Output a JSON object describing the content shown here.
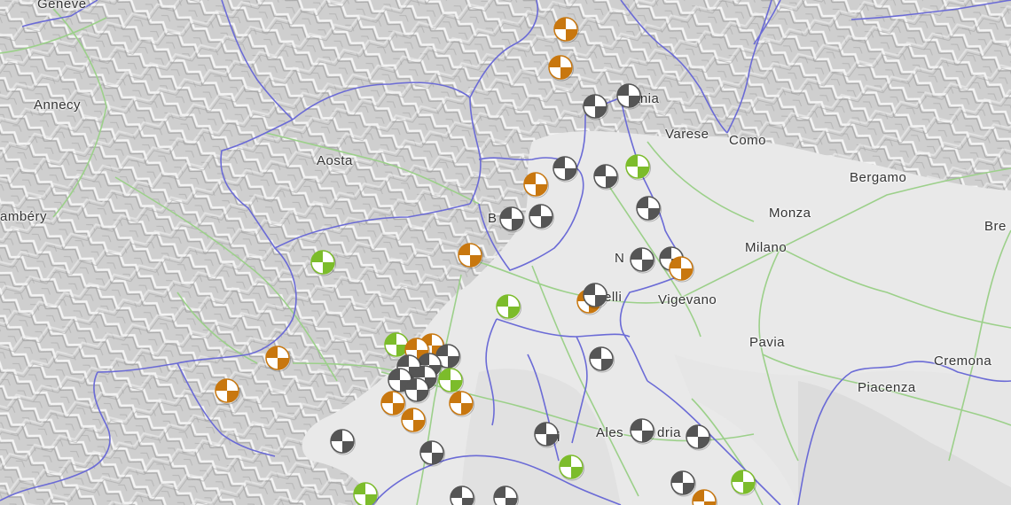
{
  "map": {
    "colors": {
      "land_mountain": "#c9c9c9",
      "land_plain": "#ebebeb",
      "border": "#6b6bd6",
      "road": "#9cd08a",
      "gray_marker": "#555555",
      "orange_marker": "#c8770f",
      "green_marker": "#7cbc2b"
    },
    "cities": {
      "geneve": "Genève",
      "annecy": "Annecy",
      "chambery": "ambéry",
      "aosta": "Aosta",
      "biella": "B",
      "verbania": "ania",
      "varese": "Varese",
      "como": "Como",
      "bergamo": "Bergamo",
      "brescia": "Bre",
      "monza": "Monza",
      "milano": "Milano",
      "novara": "N",
      "vercelli": "elli",
      "vigevano": "Vigevano",
      "pavia": "Pavia",
      "cremona": "Cremona",
      "piacenza": "Piacenza",
      "alessandria_a": "Ales",
      "alessandria_b": "dria",
      "asti": "i"
    },
    "marker_types": [
      "gray-station-icon",
      "orange-station-icon",
      "green-station-icon"
    ]
  }
}
